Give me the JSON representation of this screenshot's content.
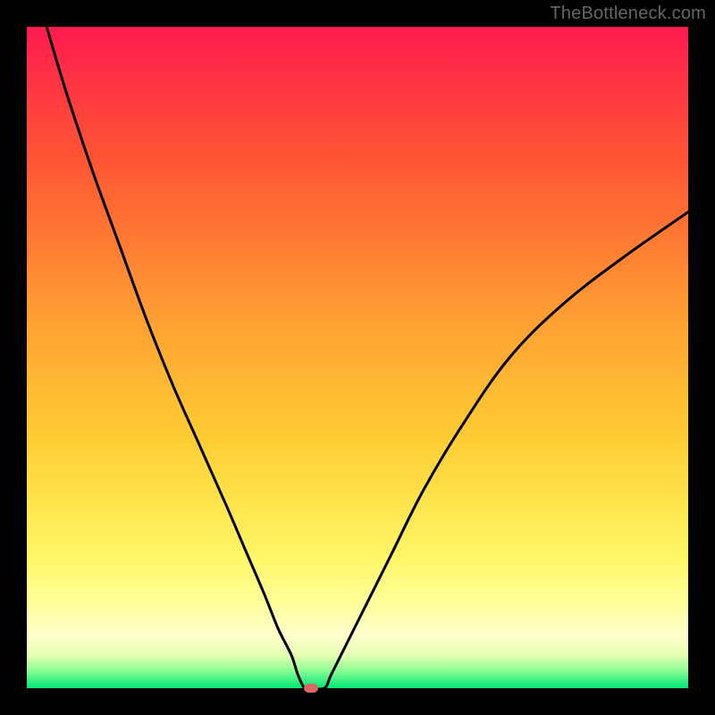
{
  "watermark": {
    "text": "TheBottleneck.com"
  },
  "chart_data": {
    "type": "line",
    "title": "",
    "xlabel": "",
    "ylabel": "",
    "xlim": [
      0,
      100
    ],
    "ylim": [
      0,
      100
    ],
    "grid": false,
    "legend": false,
    "background": "red-to-green vertical gradient",
    "series": [
      {
        "name": "curve",
        "x": [
          3,
          6,
          10,
          14,
          18,
          22,
          26,
          30,
          33,
          36,
          38,
          40,
          41,
          42,
          43,
          45,
          46,
          48,
          51,
          55,
          60,
          66,
          73,
          81,
          90,
          100
        ],
        "y": [
          100,
          90,
          78,
          67,
          56,
          46,
          37,
          28,
          21,
          14,
          9,
          5,
          2,
          0,
          0,
          0,
          2,
          6,
          12,
          20,
          30,
          40,
          50,
          58,
          65,
          72
        ]
      }
    ],
    "marker": {
      "x": 43,
      "y": 0
    }
  }
}
